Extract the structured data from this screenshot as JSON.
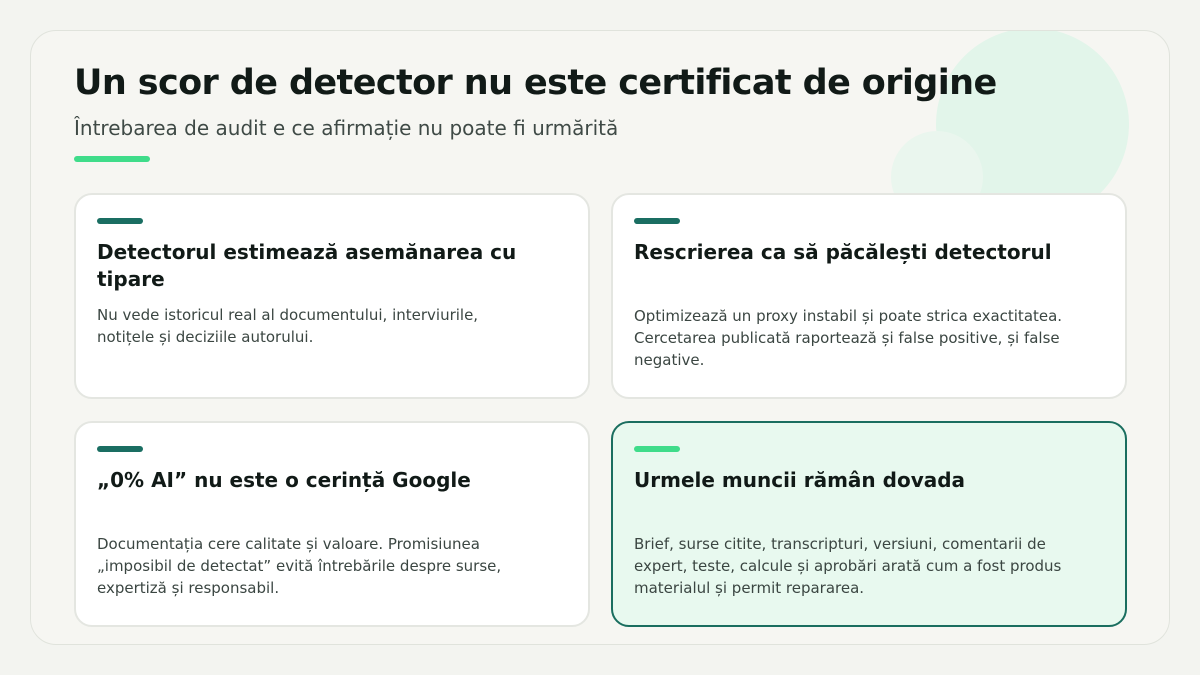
{
  "header": {
    "title": "Un scor de detector nu este certificat de origine",
    "subtitle": "Întrebarea de audit e ce afirmație nu poate fi urmărită"
  },
  "cards": [
    {
      "title": "Detectorul estimează asemănarea cu tipare",
      "text": "Nu vede istoricul real al documentului, interviurile, notițele și deciziile autorului."
    },
    {
      "title": "Rescrierea ca să păcălești detectorul",
      "text": "Optimizează un proxy instabil și poate strica exactitatea. Cercetarea publicată raportează și false positive, și false negative."
    },
    {
      "title": "„0% AI” nu este o cerință Google",
      "text": "Documentația cere calitate și valoare. Promisiunea „imposibil de detectat” evită întrebările despre surse, expertiză și responsabil."
    },
    {
      "title": "Urmele muncii rămân dovada",
      "text": "Brief, surse citite, transcripturi, versiuni, comentarii de expert, teste, calcule și aprobări arată cum a fost produs materialul și permit repararea."
    }
  ],
  "colors": {
    "accent": "#3fdc8a",
    "dark_teal": "#1a6e62",
    "highlight_bg": "#e8f9ef"
  }
}
